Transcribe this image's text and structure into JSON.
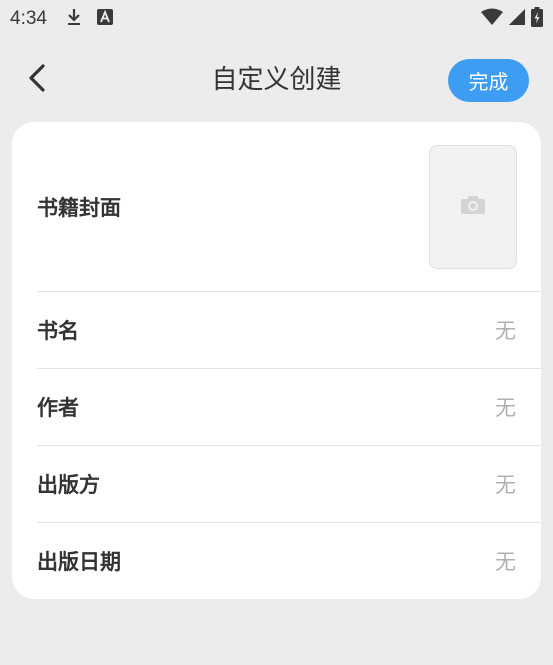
{
  "status_bar": {
    "time": "4:34",
    "icons_left": [
      "download-icon",
      "text-app-icon"
    ],
    "icons_right": [
      "wifi-icon",
      "signal-icon",
      "battery-icon"
    ]
  },
  "header": {
    "title": "自定义创建",
    "done_label": "完成",
    "back_icon": "chevron-left-icon"
  },
  "form": {
    "cover_label": "书籍封面",
    "cover_icon": "camera-icon",
    "rows": [
      {
        "label": "书名",
        "value": "无"
      },
      {
        "label": "作者",
        "value": "无"
      },
      {
        "label": "出版方",
        "value": "无"
      },
      {
        "label": "出版日期",
        "value": "无"
      }
    ]
  },
  "colors": {
    "accent": "#3d9df3",
    "background": "#ececec",
    "card": "#ffffff",
    "placeholder_text": "#b0b0b0"
  }
}
